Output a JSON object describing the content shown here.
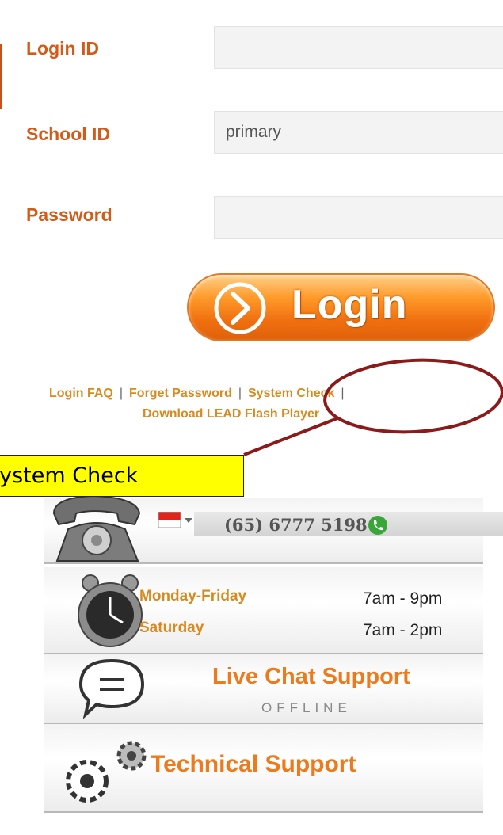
{
  "form": {
    "login_id": {
      "label": "Login ID",
      "value": ""
    },
    "school_id": {
      "label": "School ID",
      "value": "primary"
    },
    "password": {
      "label": "Password",
      "value": ""
    },
    "login_button": "Login"
  },
  "links": {
    "faq": "Login FAQ",
    "forget": "Forget Password",
    "system_check": "System Check",
    "separator": "|",
    "download": "Download LEAD Flash Player"
  },
  "callout": {
    "text": "System Check"
  },
  "support": {
    "phone": {
      "number": "(65) 6777 5198",
      "flag": "singapore-flag-icon"
    },
    "hours": [
      {
        "day": "Monday-Friday",
        "time": "7am - 9pm"
      },
      {
        "day": "Saturday",
        "time": "7am - 2pm"
      }
    ],
    "chat": {
      "title": "Live Chat Support",
      "status": "OFFLINE"
    },
    "tech": {
      "title": "Technical Support"
    }
  },
  "colors": {
    "label_orange": "#d35b17",
    "link_orange": "#d88a1e",
    "annotation": "#8b1a1a",
    "callout_bg": "#ffff00"
  }
}
